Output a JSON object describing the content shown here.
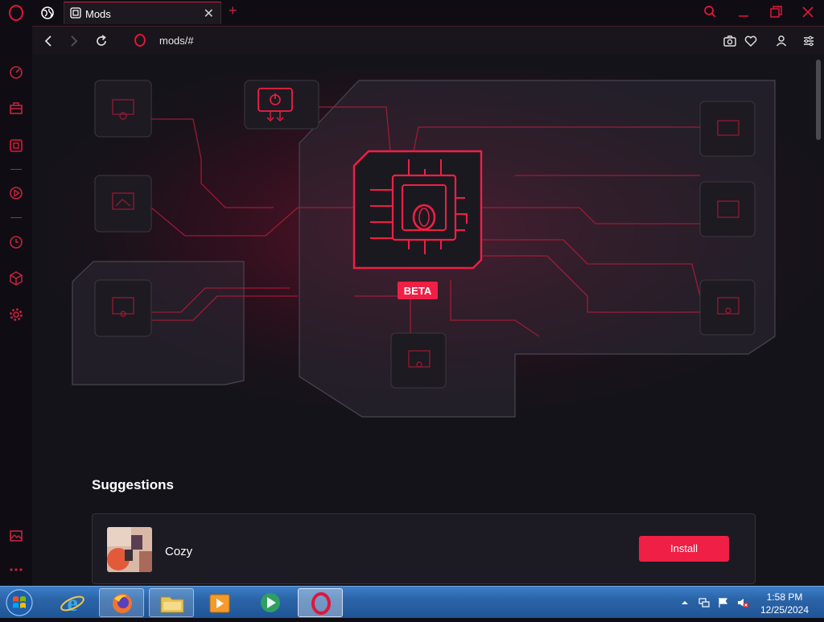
{
  "colors": {
    "accent": "#f01f45",
    "background": "#15131a",
    "chrome": "#0f0d13"
  },
  "tab": {
    "title": "Mods",
    "close": "✕",
    "new_tab": "+"
  },
  "address_bar": {
    "url": "mods/#"
  },
  "hero": {
    "badge": "BETA"
  },
  "suggestions": {
    "title": "Suggestions",
    "items": [
      {
        "name": "Cozy",
        "action": "Install"
      }
    ]
  },
  "taskbar": {
    "time": "1:58 PM",
    "date": "12/25/2024",
    "apps": [
      "internet-explorer-icon",
      "firefox-icon",
      "file-explorer-icon",
      "media-player-icon",
      "media-center-icon",
      "opera-icon"
    ]
  },
  "sidebar": {
    "icons": [
      "speed-dial-icon",
      "briefcase-icon",
      "mods-icon",
      "player-icon",
      "history-icon",
      "extensions-icon",
      "settings-icon",
      "gallery-icon",
      "more-icon"
    ]
  }
}
